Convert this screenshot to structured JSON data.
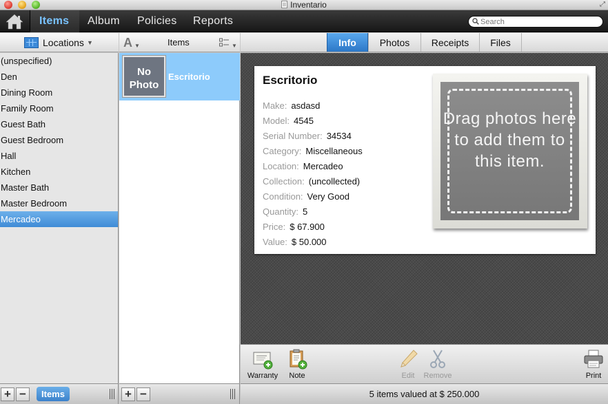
{
  "window": {
    "title": "Inventario"
  },
  "toolbar": {
    "tabs": [
      "Items",
      "Album",
      "Policies",
      "Reports"
    ],
    "search_placeholder": "Search"
  },
  "columns": {
    "locations_header": "Locations",
    "items_header": "Items"
  },
  "detail_tabs": [
    "Info",
    "Photos",
    "Receipts",
    "Files"
  ],
  "locations": [
    "(unspecified)",
    "Den",
    "Dining Room",
    "Family Room",
    "Guest Bath",
    "Guest Bedroom",
    "Hall",
    "Kitchen",
    "Master Bath",
    "Master Bedroom",
    "Mercadeo"
  ],
  "selected_location": "Mercadeo",
  "items": [
    {
      "thumb_text": "No Photo",
      "name": "Escritorio"
    }
  ],
  "detail": {
    "title": "Escritorio",
    "fields": [
      {
        "label": "Make:",
        "value": "asdasd"
      },
      {
        "label": "Model:",
        "value": "4545"
      },
      {
        "label": "Serial Number:",
        "value": "34534"
      },
      {
        "label": "Category:",
        "value": "Miscellaneous"
      },
      {
        "label": "Location:",
        "value": "Mercadeo"
      },
      {
        "label": "Collection:",
        "value": "(uncollected)"
      },
      {
        "label": "Condition:",
        "value": "Very Good"
      },
      {
        "label": "Quantity:",
        "value": "5"
      },
      {
        "label": "Price:",
        "value": "$ 67.900"
      },
      {
        "label": "Value:",
        "value": "$ 50.000"
      }
    ],
    "photo_placeholder": "Drag photos here to add them to this item."
  },
  "actions": {
    "warranty": "Warranty",
    "note": "Note",
    "edit": "Edit",
    "remove": "Remove",
    "print": "Print"
  },
  "bottom": {
    "items_pill": "Items",
    "add": "+",
    "remove": "−",
    "status": "5 items valued at $ 250.000"
  },
  "colors": {
    "accent_blue": "#3f8bd6",
    "selected_item_bg": "#8dcbfb",
    "active_nav_text": "#79c3ff"
  },
  "icons": [
    "home-icon",
    "search-icon",
    "locations-icon",
    "sort-icon",
    "view-options-icon",
    "warranty-icon",
    "note-icon",
    "edit-icon",
    "remove-icon",
    "print-icon"
  ]
}
